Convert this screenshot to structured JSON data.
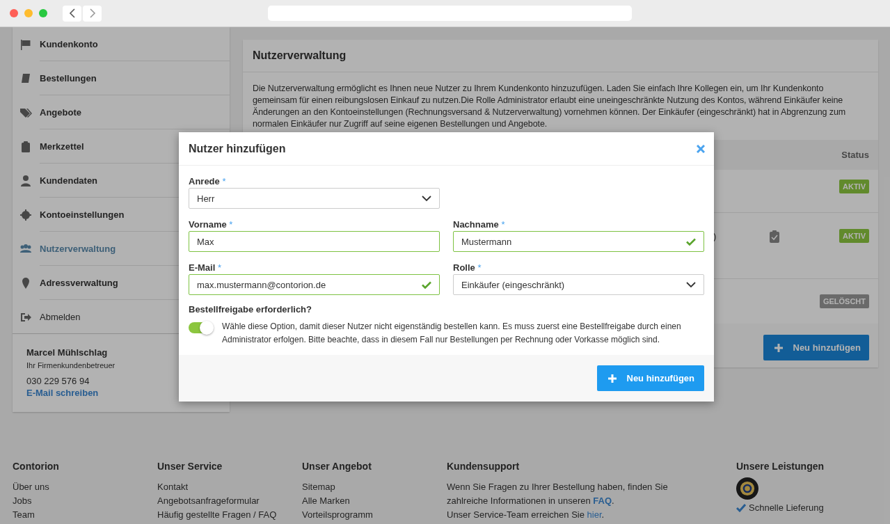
{
  "sidebar": {
    "items": [
      {
        "label": "Kundenkonto",
        "kind": "nav",
        "selected": false
      },
      {
        "label": "Bestellungen",
        "kind": "nav",
        "selected": false
      },
      {
        "label": "Angebote",
        "kind": "nav",
        "selected": false
      },
      {
        "label": "Merkzettel",
        "kind": "nav",
        "selected": false
      },
      {
        "label": "Kundendaten",
        "kind": "nav",
        "selected": false
      },
      {
        "label": "Kontoeinstellungen",
        "kind": "nav",
        "selected": false
      },
      {
        "label": "Nutzerverwaltung",
        "kind": "nav",
        "selected": true
      },
      {
        "label": "Adressverwaltung",
        "kind": "nav",
        "selected": false
      },
      {
        "label": "Abmelden",
        "kind": "logout",
        "selected": false
      }
    ],
    "contact": {
      "name": "Marcel Mühlschlag",
      "role": "Ihr Firmenkundenbetreuer",
      "phone": "030 229 576 94",
      "email_link": "E-Mail schreiben"
    }
  },
  "main": {
    "title": "Nutzerverwaltung",
    "description": "Die Nutzerverwaltung ermöglicht es Ihnen neue Nutzer zu Ihrem Kundenkonto hinzuzufügen. Laden Sie einfach Ihre Kollegen ein, um Ihr Kundenkonto gemeinsam für einen reibungslosen Einkauf zu nutzen.Die Rolle Administrator erlaubt eine uneingeschränkte Nutzung des Kontos, während Einkäufer keine Änderungen an den Kontoeinstellungen (Rechnungsversand & Nutzerverwaltung) vornehmen können. Der Einkäufer (eingeschränkt) hat in Abgrenzung zum normalen Einkäufer nur Zugriff auf seine eigenen Bestellungen und Angebote.",
    "table": {
      "status_header": "Status",
      "rows": [
        {
          "status": "AKTIV",
          "deleted": false,
          "approval_icon": false
        },
        {
          "column_2": ")",
          "status": "AKTIV",
          "deleted": false,
          "approval_icon": true
        },
        {
          "status": "GELÖSCHT",
          "deleted": true,
          "approval_icon": false
        }
      ]
    },
    "add_button": "Neu hinzufügen"
  },
  "modal": {
    "title": "Nutzer hinzufügen",
    "rows": [
      [
        {
          "label": "Anrede",
          "required_mark": "*",
          "kind": "select",
          "value": "Herr",
          "valid": false
        }
      ],
      [
        {
          "label": "Vorname",
          "required_mark": "*",
          "kind": "text",
          "value": "Max",
          "valid": true,
          "checkmark": false
        },
        {
          "label": "Nachname",
          "required_mark": "*",
          "kind": "text",
          "value": "Mustermann",
          "valid": true,
          "checkmark": true
        }
      ],
      [
        {
          "label": "E-Mail",
          "required_mark": "*",
          "kind": "text",
          "value": "max.mustermann@contorion.de",
          "valid": true,
          "checkmark": true
        },
        {
          "label": "Rolle",
          "required_mark": "*",
          "kind": "select",
          "value": "Einkäufer (eingeschränkt)",
          "valid": false
        }
      ]
    ],
    "toggle": {
      "label": "Bestellfreigabe erforderlich?",
      "on": true,
      "description": "Wähle diese Option, damit dieser Nutzer nicht eigenständig bestellen kann. Es muss zuerst eine Bestellfreigabe durch einen Administrator erfolgen. Bitte beachte, dass in diesem Fall nur Bestellungen per Rechnung oder Vorkasse möglich sind."
    },
    "submit": "Neu hinzufügen"
  },
  "footer": {
    "columns": [
      {
        "title": "Contorion",
        "links": [
          "Über uns",
          "Jobs",
          "Team"
        ]
      },
      {
        "title": "Unser Service",
        "links": [
          "Kontakt",
          "Angebotsanfrageformular",
          "Häufig gestellte Fragen / FAQ"
        ]
      },
      {
        "title": "Unser Angebot",
        "links": [
          "Sitemap",
          "Alle Marken",
          "Vorteilsprogramm"
        ]
      }
    ],
    "support": {
      "title": "Kundensupport",
      "lines": [
        {
          "before": "Wenn Sie Fragen zu Ihrer Bestellung haben, finden Sie zahlreiche Informationen in unseren ",
          "link": "FAQ",
          "after": ".",
          "bold_link": true
        },
        {
          "before": "Unser Service-Team erreichen Sie ",
          "link": "hier",
          "after": ".",
          "bold_link": false
        }
      ]
    },
    "services": {
      "title": "Unsere Leistungen",
      "items": [
        "Schnelle Lieferung"
      ]
    }
  }
}
